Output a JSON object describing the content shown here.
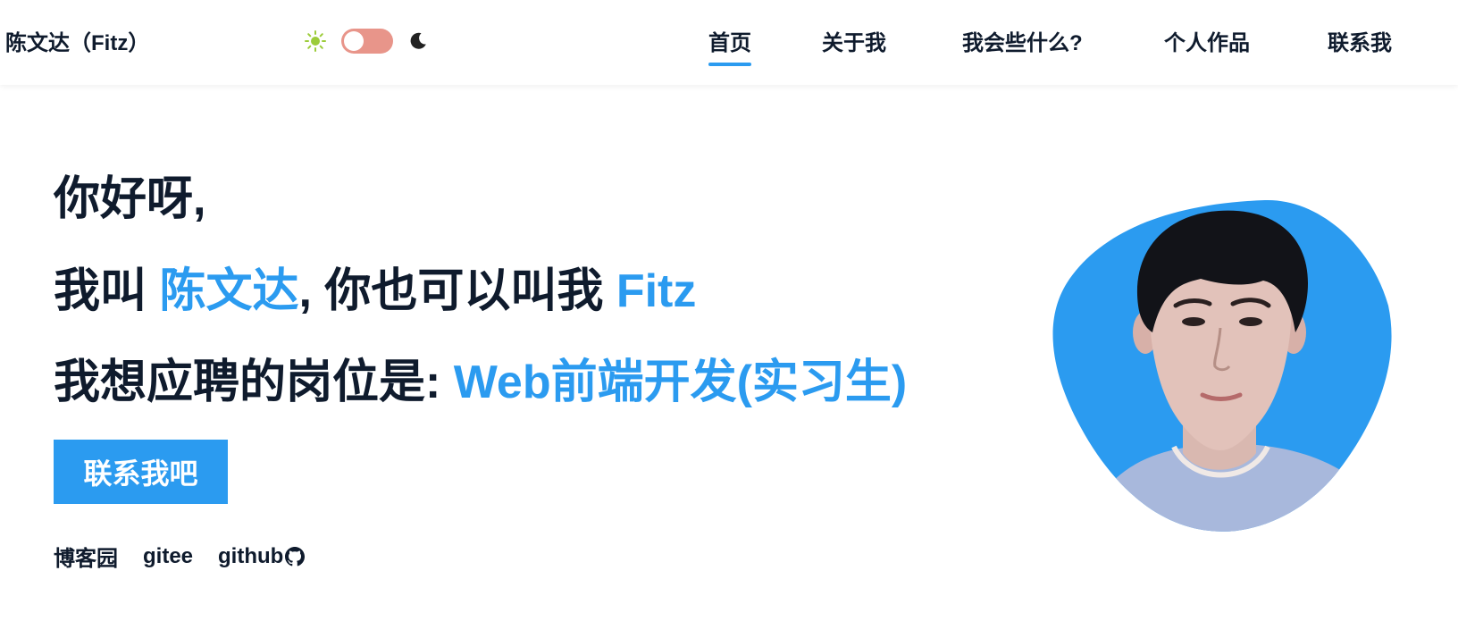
{
  "header": {
    "brand": "陈文达（Fitz）",
    "nav": [
      {
        "label": "首页",
        "active": true
      },
      {
        "label": "关于我",
        "active": false
      },
      {
        "label": "我会些什么?",
        "active": false
      },
      {
        "label": "个人作品",
        "active": false
      },
      {
        "label": "联系我",
        "active": false
      }
    ],
    "theme": {
      "sun_icon": "sun-icon",
      "moon_icon": "moon-icon",
      "toggle_color": "#e8958a"
    }
  },
  "hero": {
    "greeting": "你好呀,",
    "line2": {
      "prefix": "我叫 ",
      "name": "陈文达",
      "middle": ", 你也可以叫我 ",
      "nickname": "Fitz"
    },
    "line3": {
      "prefix": "我想应聘的岗位是: ",
      "position": "Web前端开发(实习生)"
    },
    "cta_label": "联系我吧",
    "links": [
      {
        "label": "博客园"
      },
      {
        "label": "gitee"
      },
      {
        "label": "github",
        "icon": "github-icon"
      }
    ]
  },
  "colors": {
    "accent": "#2b9bf0",
    "text": "#0f1b2d"
  }
}
